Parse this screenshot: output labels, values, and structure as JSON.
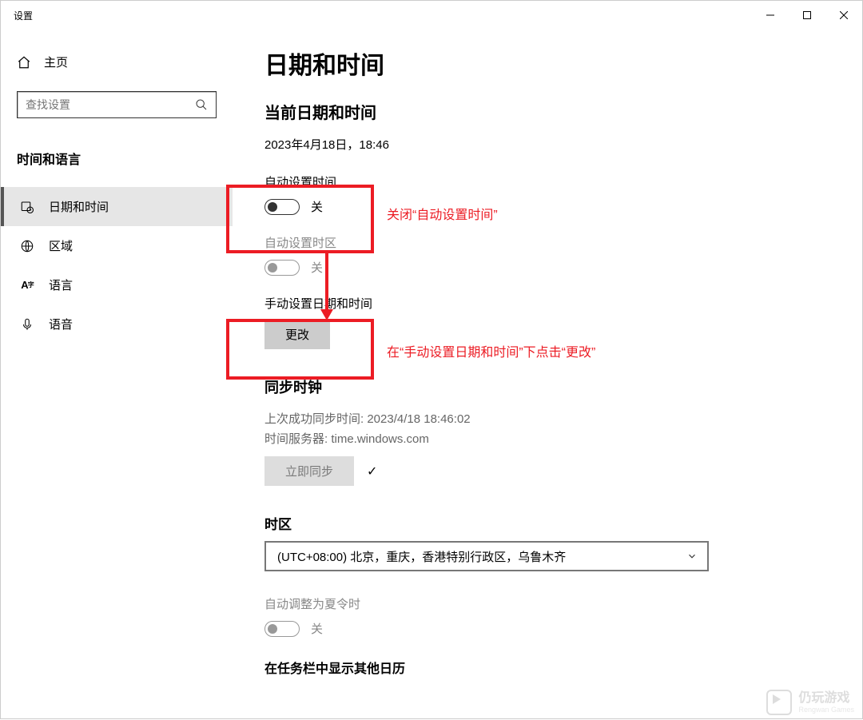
{
  "window": {
    "title": "设置"
  },
  "sidebar": {
    "home": "主页",
    "search_placeholder": "查找设置",
    "section": "时间和语言",
    "items": [
      {
        "label": "日期和时间"
      },
      {
        "label": "区域"
      },
      {
        "label": "语言"
      },
      {
        "label": "语音"
      }
    ]
  },
  "content": {
    "heading": "日期和时间",
    "current_section": "当前日期和时间",
    "current_value": "2023年4月18日，18:46",
    "auto_time": {
      "label": "自动设置时间",
      "state": "关"
    },
    "auto_zone": {
      "label": "自动设置时区",
      "state": "关"
    },
    "manual": {
      "label": "手动设置日期和时间",
      "button": "更改"
    },
    "sync": {
      "heading": "同步时钟",
      "last": "上次成功同步时间: 2023/4/18 18:46:02",
      "server": "时间服务器: time.windows.com",
      "button": "立即同步"
    },
    "timezone": {
      "heading": "时区",
      "value": "(UTC+08:00) 北京，重庆，香港特别行政区，乌鲁木齐"
    },
    "dst": {
      "label": "自动调整为夏令时",
      "state": "关"
    },
    "cut": "在任务栏中显示其他日历"
  },
  "annotations": {
    "a1": "关闭“自动设置时间”",
    "a2": "在“手动设置日期和时间”下点击“更改”"
  },
  "watermark": {
    "name": "仍玩游戏",
    "sub": "Rengwan Games"
  }
}
